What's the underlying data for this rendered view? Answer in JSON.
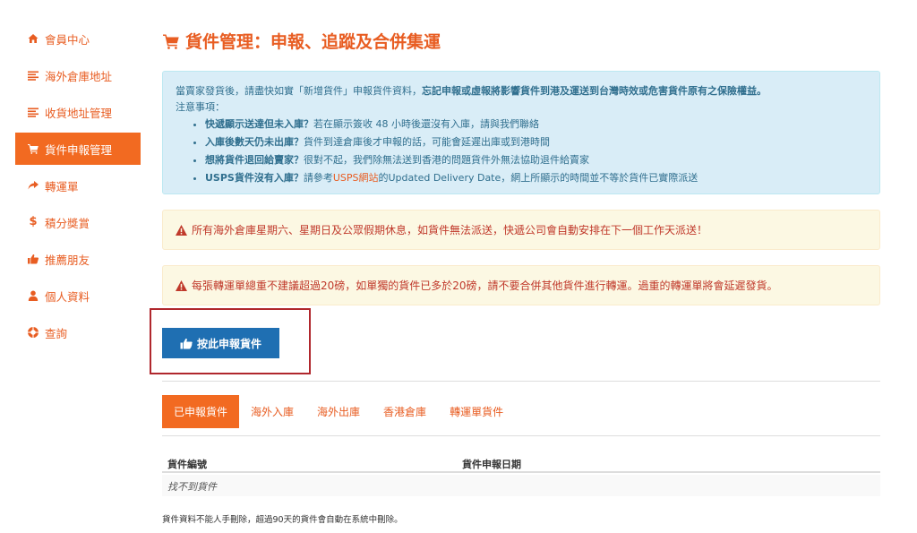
{
  "sidebar": {
    "items": [
      {
        "label": "會員中心",
        "icon": "home-icon"
      },
      {
        "label": "海外倉庫地址",
        "icon": "list-icon"
      },
      {
        "label": "收貨地址管理",
        "icon": "list-icon"
      },
      {
        "label": "貨件申報管理",
        "icon": "cart-icon",
        "active": true
      },
      {
        "label": "轉運單",
        "icon": "share-icon"
      },
      {
        "label": "積分獎賞",
        "icon": "dollar-icon"
      },
      {
        "label": "推薦朋友",
        "icon": "thumbs-up-icon"
      },
      {
        "label": "個人資料",
        "icon": "user-icon"
      },
      {
        "label": "查詢",
        "icon": "lifebuoy-icon"
      }
    ]
  },
  "page": {
    "title": "貨件管理：申報、追蹤及合併集運"
  },
  "info": {
    "intro_plain": "當賣家發貨後，請盡快如實「新增貨件」申報貨件資料，",
    "intro_bold": "忘記申報或虛報將影響貨件到港及運送到台灣時效或危害貨件原有之保險權益。",
    "notes_label": "注意事項：",
    "bullets": [
      {
        "bold": "快遞顯示送達但未入庫？",
        "text": "若在顯示簽收 48 小時後還沒有入庫，請與我們聯絡"
      },
      {
        "bold": "入庫後數天仍未出庫？",
        "text": "貨件到達倉庫後才申報的話，可能會延遲出庫或到港時間"
      },
      {
        "bold": "想將貨件退回給賣家？",
        "text": "很對不起，我們除無法送到香港的問題貨件外無法協助退件給賣家"
      },
      {
        "bold": "USPS貨件沒有入庫？",
        "text_before": "請參考",
        "link": "USPS網站",
        "text_after": "的Updated Delivery Date，網上所顯示的時間並不等於貨件已實際派送"
      }
    ]
  },
  "warnings": {
    "first": "所有海外倉庫星期六、星期日及公眾假期休息，如貨件無法派送，快遞公司會自動安排在下一個工作天派送！",
    "second": "每張轉運單總重不建議超過20磅，如單獨的貨件已多於20磅，請不要合併其他貨件進行轉運。過重的轉運單將會延遲發貨。"
  },
  "declare_button": {
    "label": "按此申報貨件"
  },
  "tabs": [
    {
      "label": "已申報貨件",
      "active": true
    },
    {
      "label": "海外入庫"
    },
    {
      "label": "海外出庫"
    },
    {
      "label": "香港倉庫"
    },
    {
      "label": "轉運單貨件"
    }
  ],
  "table": {
    "columns": [
      "貨件編號",
      "貨件申報日期"
    ],
    "empty_text": "找不到貨件"
  },
  "footnote": "貨件資料不能人手刪除，超過90天的貨件會自動在系統中刪除。",
  "colors": {
    "accent": "#f26a21",
    "info_bg": "#d9edf7",
    "warning_bg": "#fcf8e3",
    "warning_text": "#c0392b",
    "button": "#1f6fb2",
    "highlight_frame": "#b0272d"
  }
}
